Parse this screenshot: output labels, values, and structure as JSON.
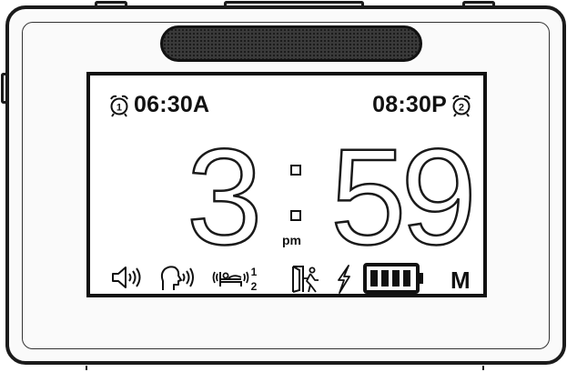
{
  "alarms": [
    {
      "number": "1",
      "time": "06:30A",
      "icon": "alarm-clock-icon"
    },
    {
      "number": "2",
      "time": "08:30P",
      "icon": "alarm-clock-icon"
    }
  ],
  "clock": {
    "hour": "3",
    "minute": "59",
    "period": "pm"
  },
  "status_icons": [
    "speaker-volume-icon",
    "voice-talking-icon",
    "snooze-sleep-icon",
    "door-exit-icon",
    "lightning-charge-icon",
    "battery-full-icon"
  ],
  "snooze_fraction": {
    "numerator": "1",
    "denominator": "2"
  },
  "battery_level": 1.0,
  "mode_label": "M",
  "colors": {
    "outline": "#1b1b1b",
    "screen_bg": "#ffffff",
    "speaker": "#3a3a3a"
  }
}
